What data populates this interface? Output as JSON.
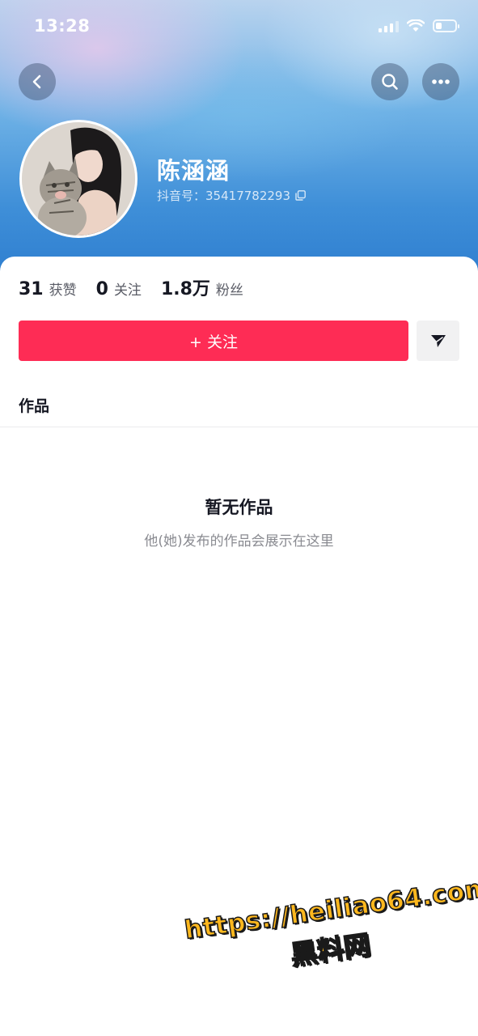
{
  "status_bar": {
    "time": "13:28",
    "battery_level": 0.3
  },
  "nav": {
    "back_icon": "chevron-left-icon",
    "search_icon": "search-icon",
    "more_icon": "more-horizontal-icon"
  },
  "profile": {
    "name": "陈涵涵",
    "douyin_id_label": "抖音号：",
    "douyin_id": "35417782293",
    "copy_icon": "copy-icon"
  },
  "stats": [
    {
      "value": "31",
      "label": "获赞"
    },
    {
      "value": "0",
      "label": "关注"
    },
    {
      "value": "1.8万",
      "label": "粉丝"
    }
  ],
  "actions": {
    "follow_label": "+ 关注",
    "share_icon": "send-icon"
  },
  "tabs": {
    "works_label": "作品"
  },
  "empty_state": {
    "title": "暂无作品",
    "subtitle": "他(她)发布的作品会展示在这里"
  },
  "watermark": {
    "line1": "https://heiliao64.com",
    "line2": "黑料网"
  },
  "colors": {
    "accent": "#fe2c55",
    "watermark_fill": "#ffb81e",
    "text_primary": "#161823"
  }
}
